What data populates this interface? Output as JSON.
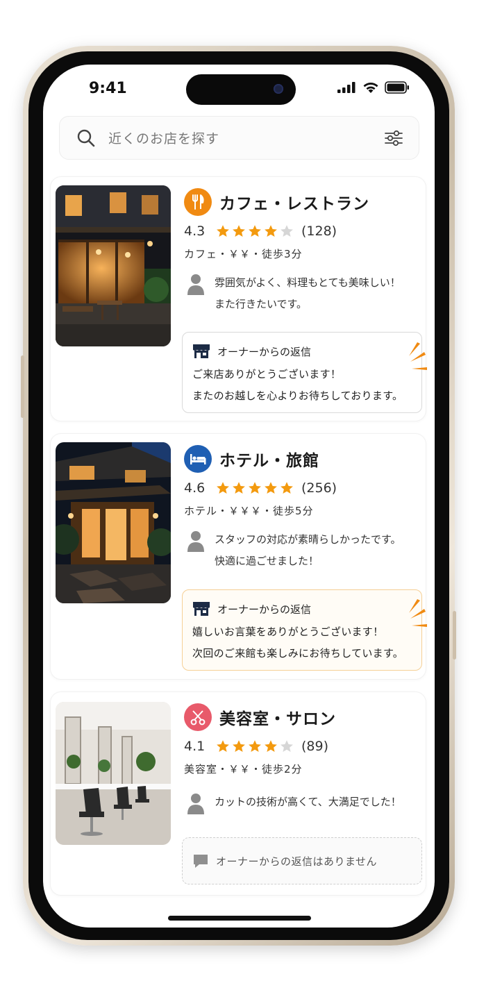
{
  "status_bar": {
    "time": "9:41"
  },
  "search": {
    "placeholder": "近くのお店を探す"
  },
  "icons": {
    "search": "search-icon",
    "filter": "filter-sliders-icon",
    "person": "user-icon",
    "store": "storefront-icon",
    "chat": "chat-bubble-icon",
    "cafe": "fork-knife-icon",
    "hotel": "bed-icon",
    "salon": "scissors-icon"
  },
  "colors": {
    "star": "#f39a0f",
    "star_empty": "#d6d6d6",
    "cafe": "#f08a12",
    "hotel": "#1f5fb3",
    "salon": "#e85a6a",
    "burst": "#f08a12"
  },
  "listings": [
    {
      "title": "カフェ・レストラン",
      "rating": "4.3",
      "rating_value": 4.3,
      "review_count": "(128)",
      "meta": "カフェ・￥￥・徒歩3分",
      "review_lines": [
        "雰囲気がよく、料理もとても美味しい！",
        "また行きたいです。"
      ],
      "reply": {
        "label": "オーナーからの返信",
        "lines": [
          "ご来店ありがとうございます！",
          "またのお越しを心よりお待ちしております。"
        ]
      }
    },
    {
      "title": "ホテル・旅館",
      "rating": "4.6",
      "rating_value": 4.6,
      "review_count": "(256)",
      "meta": "ホテル・￥￥￥・徒歩5分",
      "review_lines": [
        "スタッフの対応が素晴らしかったです。",
        "快適に過ごせました！"
      ],
      "reply": {
        "label": "オーナーからの返信",
        "lines": [
          "嬉しいお言葉をありがとうございます！",
          "次回のご来館も楽しみにお待ちしています。"
        ]
      }
    },
    {
      "title": "美容室・サロン",
      "rating": "4.1",
      "rating_value": 4.1,
      "review_count": "(89)",
      "meta": "美容室・￥￥・徒歩2分",
      "review_lines": [
        "カットの技術が高くて、大満足でした！"
      ],
      "reply": {
        "label": "オーナーからの返信はありません"
      }
    }
  ]
}
